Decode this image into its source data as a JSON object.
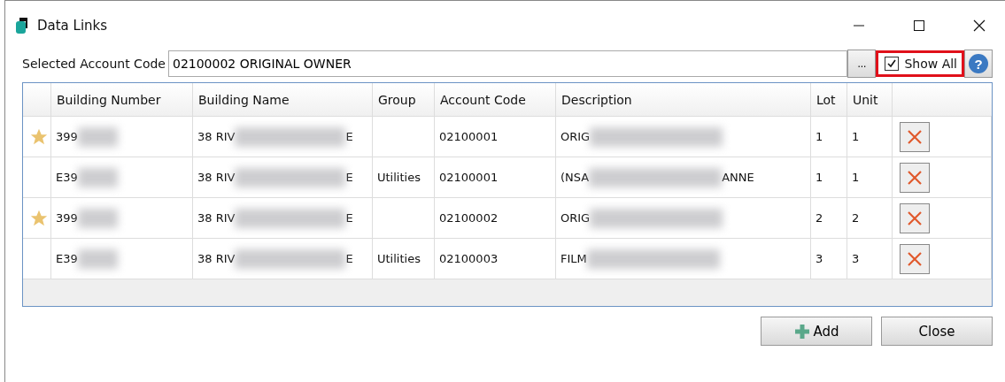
{
  "window": {
    "title": "Data Links"
  },
  "account": {
    "label": "Selected Account Code",
    "value": "02100002 ORIGINAL OWNER",
    "browse": "...",
    "show_all": {
      "label": "Show All",
      "checked": true,
      "highlighted": true
    },
    "help": "?"
  },
  "table": {
    "columns": [
      "Building Number",
      "Building Name",
      "Group",
      "Account Code",
      "Description",
      "Lot",
      "Unit"
    ],
    "rows": [
      {
        "starred": true,
        "building_number": [
          "399"
        ],
        "building_name": [
          "38 RIV",
          "E"
        ],
        "group": "",
        "account_code": "02100001",
        "description": [
          "ORIG"
        ],
        "lot": "1",
        "unit": "1"
      },
      {
        "starred": false,
        "building_number": [
          "E39"
        ],
        "building_name": [
          "38 RIV",
          "E"
        ],
        "group": "Utilities",
        "account_code": "02100001",
        "description": [
          "(NSA",
          "ANNE"
        ],
        "lot": "1",
        "unit": "1"
      },
      {
        "starred": true,
        "building_number": [
          "399"
        ],
        "building_name": [
          "38 RIV",
          "E"
        ],
        "group": "",
        "account_code": "02100002",
        "description": [
          "ORIG"
        ],
        "lot": "2",
        "unit": "2"
      },
      {
        "starred": false,
        "building_number": [
          "E39"
        ],
        "building_name": [
          "38 RIV",
          "E"
        ],
        "group": "Utilities",
        "account_code": "02100003",
        "description": [
          "FILM"
        ],
        "lot": "3",
        "unit": "3"
      }
    ]
  },
  "buttons": [
    {
      "kind": "add",
      "label": "Add"
    },
    {
      "kind": "close",
      "label": "Close"
    }
  ]
}
